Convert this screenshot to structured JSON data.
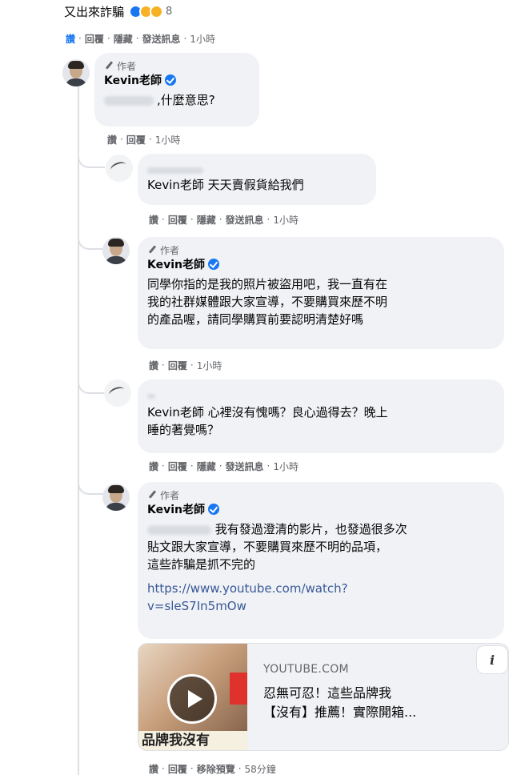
{
  "top_comment": {
    "text": "又出來詐騙",
    "reaction_count": "8",
    "actions": [
      "讚",
      "回覆",
      "隱藏",
      "發送訊息"
    ],
    "timestamp": "1小時"
  },
  "comments": [
    {
      "author_tag": "作者",
      "name": "Kevin老師",
      "text": "什麼意思?",
      "actions": [
        "讚",
        "回覆"
      ],
      "timestamp": "1小時"
    },
    {
      "text": "Kevin老師 天天賣假貨給我們",
      "actions": [
        "讚",
        "回覆",
        "隱藏",
        "發送訊息"
      ],
      "timestamp": "1小時"
    },
    {
      "author_tag": "作者",
      "name": "Kevin老師",
      "lines": [
        "同學你指的是我的照片被盜用吧，我一直有在",
        "我的社群媒體跟大家宣導，不要購買來歷不明",
        "的產品喔，請同學購買前要認明清楚好嗎"
      ],
      "actions": [
        "讚",
        "回覆"
      ],
      "timestamp": "1小時"
    },
    {
      "lines": [
        "Kevin老師 心裡沒有愧嗎？良心過得去？晚上",
        "睡的著覺嗎？"
      ],
      "actions": [
        "讚",
        "回覆",
        "隱藏",
        "發送訊息"
      ],
      "timestamp": "1小時"
    },
    {
      "author_tag": "作者",
      "name": "Kevin老師",
      "lines": [
        "我有發過澄清的影片，也發過很多次",
        "貼文跟大家宣導，不要購買來歷不明的品項，",
        "這些詐騙是抓不完的"
      ],
      "link_lines": [
        "https://www.youtube.com/watch?",
        "v=sleS7In5mOw"
      ],
      "actions": [
        "讚",
        "回覆",
        "移除預覽"
      ],
      "timestamp": "58分鐘"
    }
  ],
  "preview": {
    "source": "YOUTUBE.COM",
    "title_lines": [
      "忍無可忍！這些品牌我",
      "【沒有】推薦！實際開箱..."
    ],
    "thumb_text": "品牌我沒有"
  }
}
